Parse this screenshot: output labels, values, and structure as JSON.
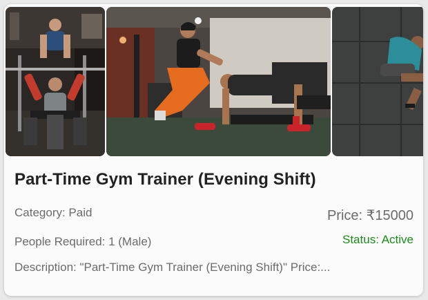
{
  "listing": {
    "title": "Part-Time Gym Trainer (Evening Shift)",
    "category": "Category: Paid",
    "people_required": "People Required: 1 (Male)",
    "description": "Description: \"Part-Time Gym Trainer (Evening Shift)\" Price:...",
    "price": "Price: ₹15000",
    "status": "Status: Active",
    "status_color": "#1a8a1a"
  },
  "gallery": {
    "images": [
      {
        "name": "bench-press-spotter-photo"
      },
      {
        "name": "trainer-pushup-photo"
      },
      {
        "name": "stretching-photo"
      }
    ]
  }
}
